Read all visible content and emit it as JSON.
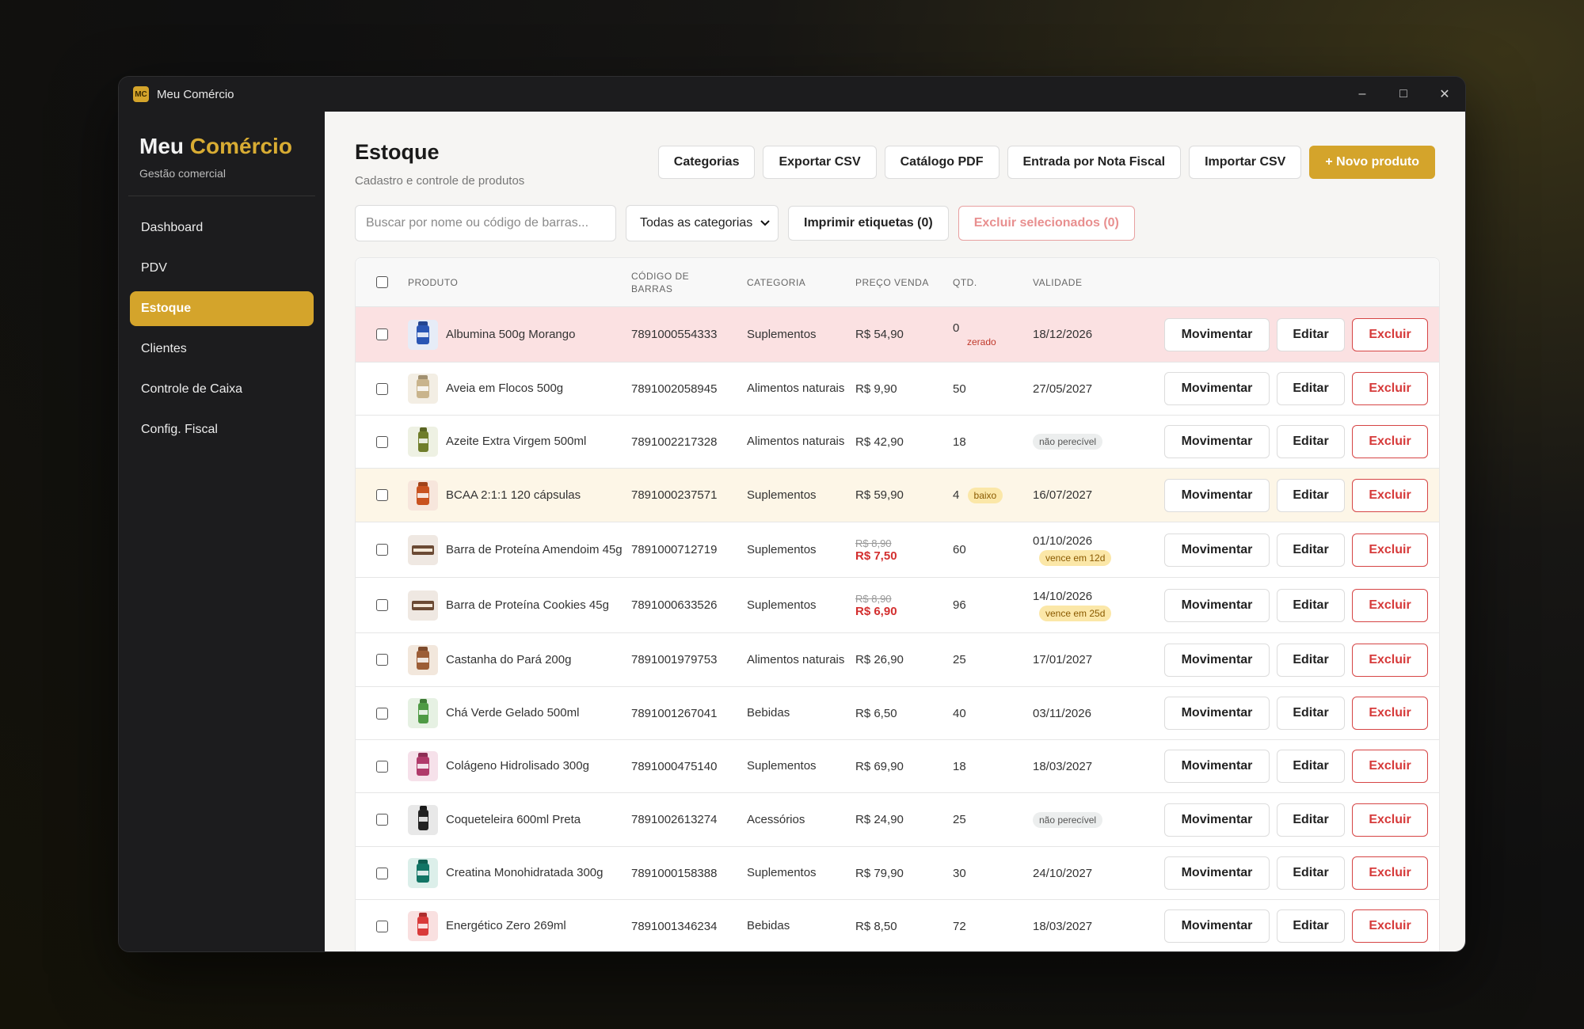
{
  "window": {
    "title": "Meu Comércio",
    "icon_text": "MC"
  },
  "sidebar": {
    "brand_main": "Meu",
    "brand_accent": "Comércio",
    "brand_sub": "Gestão comercial",
    "items": [
      {
        "label": "Dashboard"
      },
      {
        "label": "PDV"
      },
      {
        "label": "Estoque",
        "active": true
      },
      {
        "label": "Clientes"
      },
      {
        "label": "Controle de Caixa"
      },
      {
        "label": "Config. Fiscal"
      }
    ]
  },
  "header": {
    "title": "Estoque",
    "subtitle": "Cadastro e controle de produtos"
  },
  "actions": {
    "categorias": "Categorias",
    "exportar": "Exportar CSV",
    "catalogo": "Catálogo PDF",
    "nota": "Entrada por Nota Fiscal",
    "importar": "Importar CSV",
    "novo": "+ Novo produto"
  },
  "toolbar": {
    "search_placeholder": "Buscar por nome ou código de barras...",
    "category_select": "Todas as categorias",
    "print_labels": "Imprimir etiquetas (0)",
    "delete_selected": "Excluir selecionados (0)"
  },
  "table": {
    "headers": {
      "product": "PRODUTO",
      "code_1": "CÓDIGO DE",
      "code_2": "BARRAS",
      "category": "CATEGORIA",
      "price": "PREÇO VENDA",
      "qty": "QTD.",
      "validity": "VALIDADE"
    },
    "action_labels": {
      "move": "Movimentar",
      "edit": "Editar",
      "delete": "Excluir"
    },
    "rows": [
      {
        "name": "Albumina 500g Morango",
        "code": "7891000554333",
        "category": "Suplementos",
        "price": "R$ 54,90",
        "qty": "0",
        "qty_badge": "zerado",
        "validity": "18/12/2026"
      },
      {
        "name": "Aveia em Flocos 500g",
        "code": "7891002058945",
        "category": "Alimentos naturais",
        "price": "R$ 9,90",
        "qty": "50",
        "validity": "27/05/2027"
      },
      {
        "name": "Azeite Extra Virgem 500ml",
        "code": "7891002217328",
        "category": "Alimentos naturais",
        "price": "R$ 42,90",
        "qty": "18",
        "validity_badge": "não perecível"
      },
      {
        "name": "BCAA 2:1:1 120 cápsulas",
        "code": "7891000237571",
        "category": "Suplementos",
        "price": "R$ 59,90",
        "qty": "4",
        "qty_badge": "baixo",
        "validity": "16/07/2027"
      },
      {
        "name": "Barra de Proteína Amendoim 45g",
        "code": "7891000712719",
        "category": "Suplementos",
        "old_price": "R$ 8,90",
        "price": "R$ 7,50",
        "qty": "60",
        "validity": "01/10/2026",
        "validity_badge": "vence em 12d"
      },
      {
        "name": "Barra de Proteína Cookies 45g",
        "code": "7891000633526",
        "category": "Suplementos",
        "old_price": "R$ 8,90",
        "price": "R$ 6,90",
        "qty": "96",
        "validity": "14/10/2026",
        "validity_badge": "vence em 25d"
      },
      {
        "name": "Castanha do Pará 200g",
        "code": "7891001979753",
        "category": "Alimentos naturais",
        "price": "R$ 26,90",
        "qty": "25",
        "validity": "17/01/2027"
      },
      {
        "name": "Chá Verde Gelado 500ml",
        "code": "7891001267041",
        "category": "Bebidas",
        "price": "R$ 6,50",
        "qty": "40",
        "validity": "03/11/2026"
      },
      {
        "name": "Colágeno Hidrolisado 300g",
        "code": "7891000475140",
        "category": "Suplementos",
        "price": "R$ 69,90",
        "qty": "18",
        "validity": "18/03/2027"
      },
      {
        "name": "Coqueteleira 600ml Preta",
        "code": "7891002613274",
        "category": "Acessórios",
        "price": "R$ 24,90",
        "qty": "25",
        "validity_badge": "não perecível"
      },
      {
        "name": "Creatina Monohidratada 300g",
        "code": "7891000158388",
        "category": "Suplementos",
        "price": "R$ 79,90",
        "qty": "30",
        "validity": "24/10/2027"
      },
      {
        "name": "Energético Zero 269ml",
        "code": "7891001346234",
        "category": "Bebidas",
        "price": "R$ 8,50",
        "qty": "72",
        "validity": "18/03/2027"
      }
    ]
  }
}
